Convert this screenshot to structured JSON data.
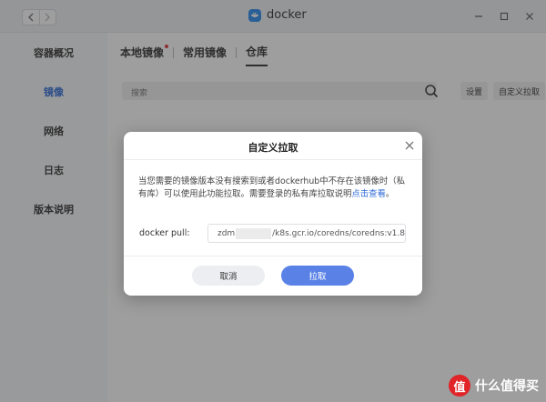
{
  "app": {
    "title": "docker"
  },
  "sidebar": {
    "items": [
      {
        "label": "容器概况"
      },
      {
        "label": "镜像",
        "active": true
      },
      {
        "label": "网络"
      },
      {
        "label": "日志"
      },
      {
        "label": "版本说明"
      }
    ]
  },
  "main": {
    "tabs": [
      {
        "label": "本地镜像",
        "has_dot": true
      },
      {
        "label": "常用镜像"
      },
      {
        "label": "仓库",
        "active": true
      }
    ],
    "search_placeholder": "搜索",
    "settings_label": "设置",
    "custom_pull_label": "自定义拉取"
  },
  "dialog": {
    "title": "自定义拉取",
    "description": "当您需要的镜像版本没有搜索到或者dockerhub中不存在该镜像时（私有库）可以使用此功能拉取。需要登录的私有库拉取说明",
    "link_text": "点击查看",
    "period": "。",
    "pull_label": "docker pull:",
    "pull_value_prefix": "zdm",
    "pull_value_suffix": "/k8s.gcr.io/coredns/coredns:v1.8",
    "cancel_label": "取消",
    "confirm_label": "拉取"
  },
  "watermark": {
    "badge": "值",
    "text": "什么值得买"
  },
  "colors": {
    "accent": "#5a82e6",
    "link": "#2f6bd8",
    "dot": "#e0393e"
  }
}
